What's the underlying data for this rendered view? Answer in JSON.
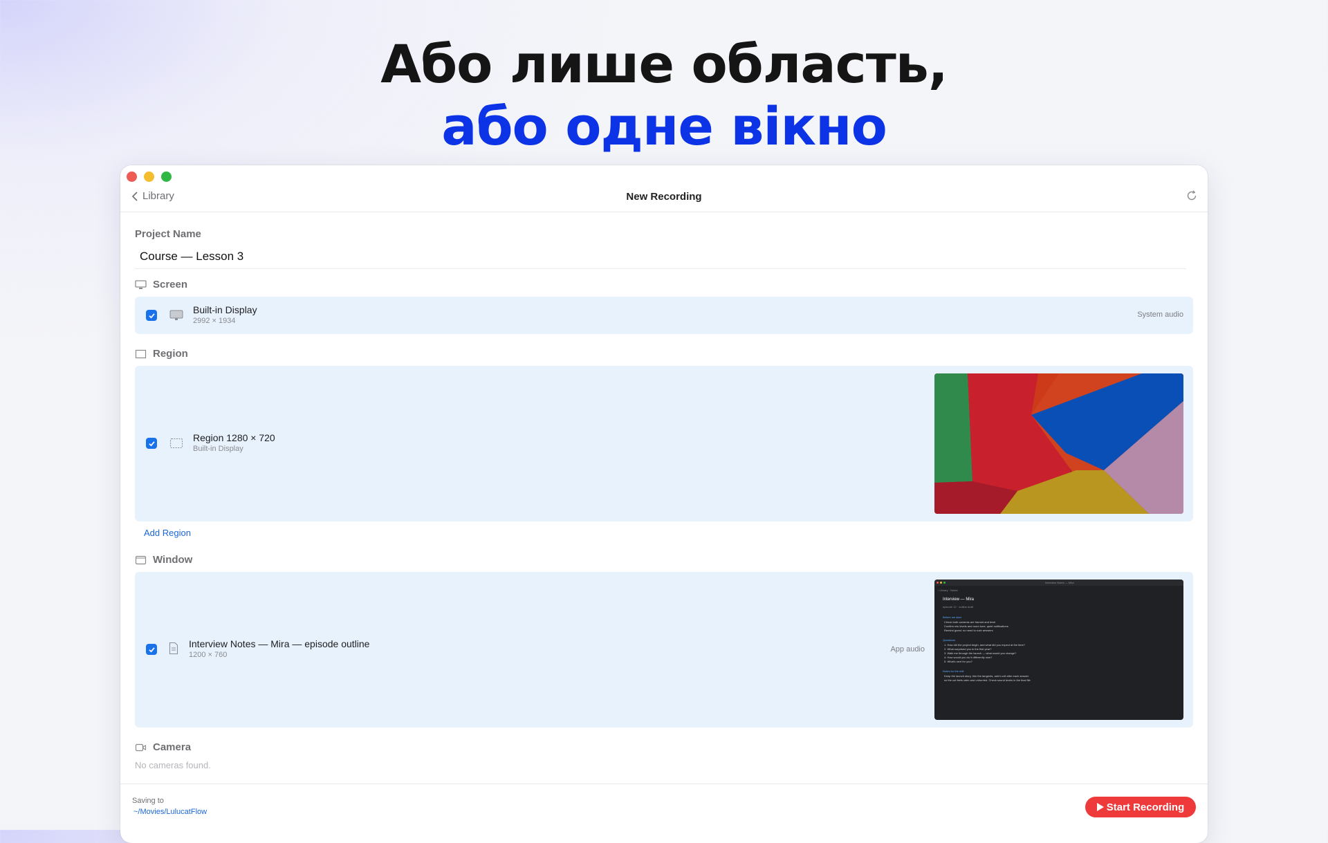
{
  "headline": {
    "line1": "Або лише область,",
    "line2": "або одне вікно"
  },
  "window": {
    "back_label": "Library",
    "title": "New Recording",
    "project_name_label": "Project Name",
    "project_name_value": "Course — Lesson 3",
    "screen": {
      "heading": "Screen",
      "item": {
        "title": "Built-in Display",
        "subtitle": "2992 × 1934",
        "audio": "System audio",
        "checked": true
      }
    },
    "region": {
      "heading": "Region",
      "item": {
        "title": "Region 1280 × 720",
        "subtitle": "Built-in Display",
        "checked": true
      },
      "add_label": "Add Region"
    },
    "window_section": {
      "heading": "Window",
      "item": {
        "title": "Interview Notes — Mira — episode outline",
        "subtitle": "1200 × 760",
        "audio": "App audio",
        "checked": true
      }
    },
    "camera": {
      "heading": "Camera",
      "empty_text": "No cameras found."
    },
    "footer": {
      "saving_label": "Saving to",
      "path": "~/Movies/LulucatFlow",
      "start_label": "Start Recording"
    }
  },
  "colors": {
    "accent_blue": "#1a72ea",
    "headline_blue": "#0c33e6",
    "record_red": "#ee3a3a",
    "row_bg": "#e8f2fd"
  },
  "icons": [
    "chevron-left-icon",
    "refresh-icon",
    "display-icon",
    "region-icon",
    "window-icon",
    "document-icon",
    "camera-icon",
    "checkmark-icon",
    "play-icon"
  ]
}
